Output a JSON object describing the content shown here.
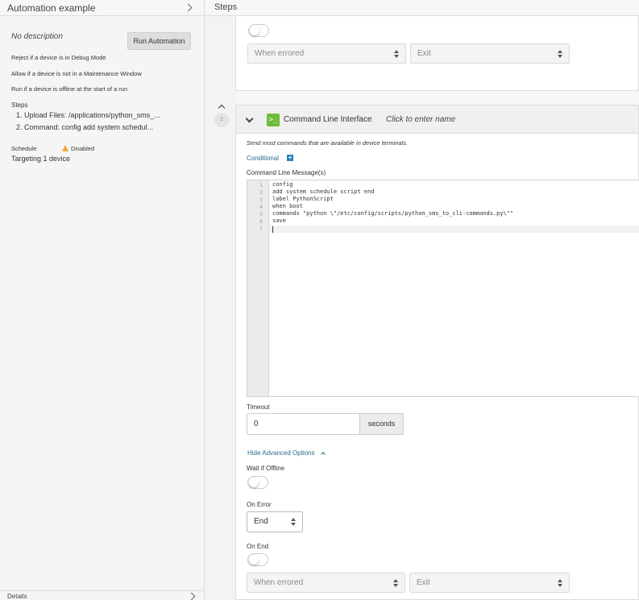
{
  "left_panel": {
    "title": "Automation example",
    "description": "No description",
    "run_button": "Run Automation",
    "rules": [
      "Reject if a device is in Debug Mode",
      "Allow if a device is not in a Maintenance Window",
      "Run if a device is offline at the start of a run"
    ],
    "steps_label": "Steps",
    "steps": [
      "1. Upload Files: /applications/python_sms_...",
      "2. Command: config add system schedul..."
    ],
    "schedule_label": "Schedule",
    "schedule_status": "Disabled",
    "targeting": "Targeting 1 device",
    "details_label": "Details"
  },
  "right_panel": {
    "title": "Steps",
    "prev_step": {
      "condition_select": "When errored",
      "action_select": "Exit",
      "toggle_on": false
    },
    "step": {
      "number": "2",
      "type_title": "Command Line Interface",
      "name_placeholder": "Click to enter name",
      "description": "Send most commands that are available in device terminals.",
      "conditional_label": "Conditional",
      "messages_label": "Command Line Message(s)",
      "code_lines": [
        "config",
        "add system schedule script end",
        "label PythonScript",
        "when boot",
        "commands \"python \\\"/etc/config/scripts/python_sms_to_cli-commands.py\\\"\"",
        "save",
        ""
      ],
      "line_numbers": [
        "1",
        "2",
        "3",
        "4",
        "5",
        "6",
        "7"
      ],
      "timeout_label": "Timeout",
      "timeout_value": "0",
      "timeout_unit": "seconds",
      "advanced_link": "Hide Advanced Options",
      "wait_offline_label": "Wait if Offline",
      "wait_offline_on": false,
      "on_error_label": "On Error",
      "on_error_value": "End",
      "on_end_label": "On End",
      "on_end_on": false,
      "end_condition_select": "When errored",
      "end_action_select": "Exit"
    }
  },
  "colors": {
    "link": "#2a6a8a",
    "terminal_icon": "#6bbd3a",
    "warning": "#f0a53c"
  }
}
